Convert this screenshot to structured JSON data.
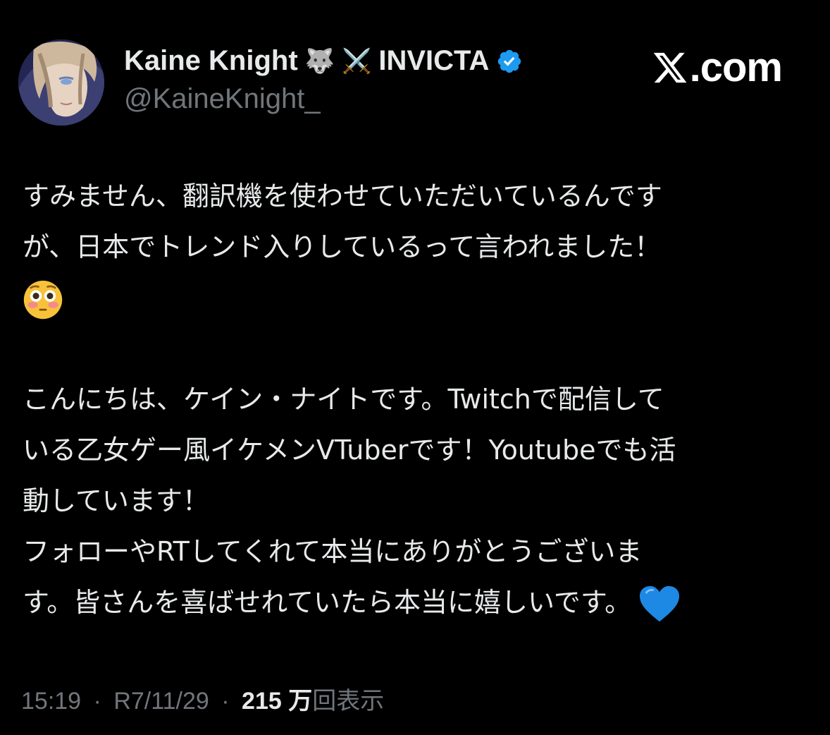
{
  "colors": {
    "background": "#000000",
    "text_primary": "#e7e9ea",
    "text_secondary": "#71767b",
    "verified_blue": "#1d9bf0",
    "heart_blue": "#1e88e5"
  },
  "author": {
    "display_name": "Kaine Knight",
    "emoji_wolf": "🐺",
    "emoji_swords": "⚔️",
    "tag": "INVICTA",
    "handle": "@KaineKnight_",
    "verified_icon": "verified-badge-icon"
  },
  "site": {
    "dotcom": ".com"
  },
  "post": {
    "line1": "すみません、翻訳機を使わせていただいているんです",
    "line2": "が、日本でトレンド入りしているって言われました！",
    "emoji1": "flushed-face-icon",
    "line3": "こんにちは、ケイン・ナイトです。Twitchで配信して",
    "line4": "いる乙女ゲー風イケメンVTuberです！Youtubeでも活",
    "line5": "動しています！",
    "line6": "フォローやRTしてくれて本当にありがとうございま",
    "line7": "す。皆さんを喜ばせれていたら本当に嬉しいです。",
    "emoji2": "blue-heart-icon"
  },
  "meta": {
    "time": "15:19",
    "separator": "·",
    "date": "R7/11/29",
    "views_count": "215 万",
    "views_label": "回表示"
  }
}
